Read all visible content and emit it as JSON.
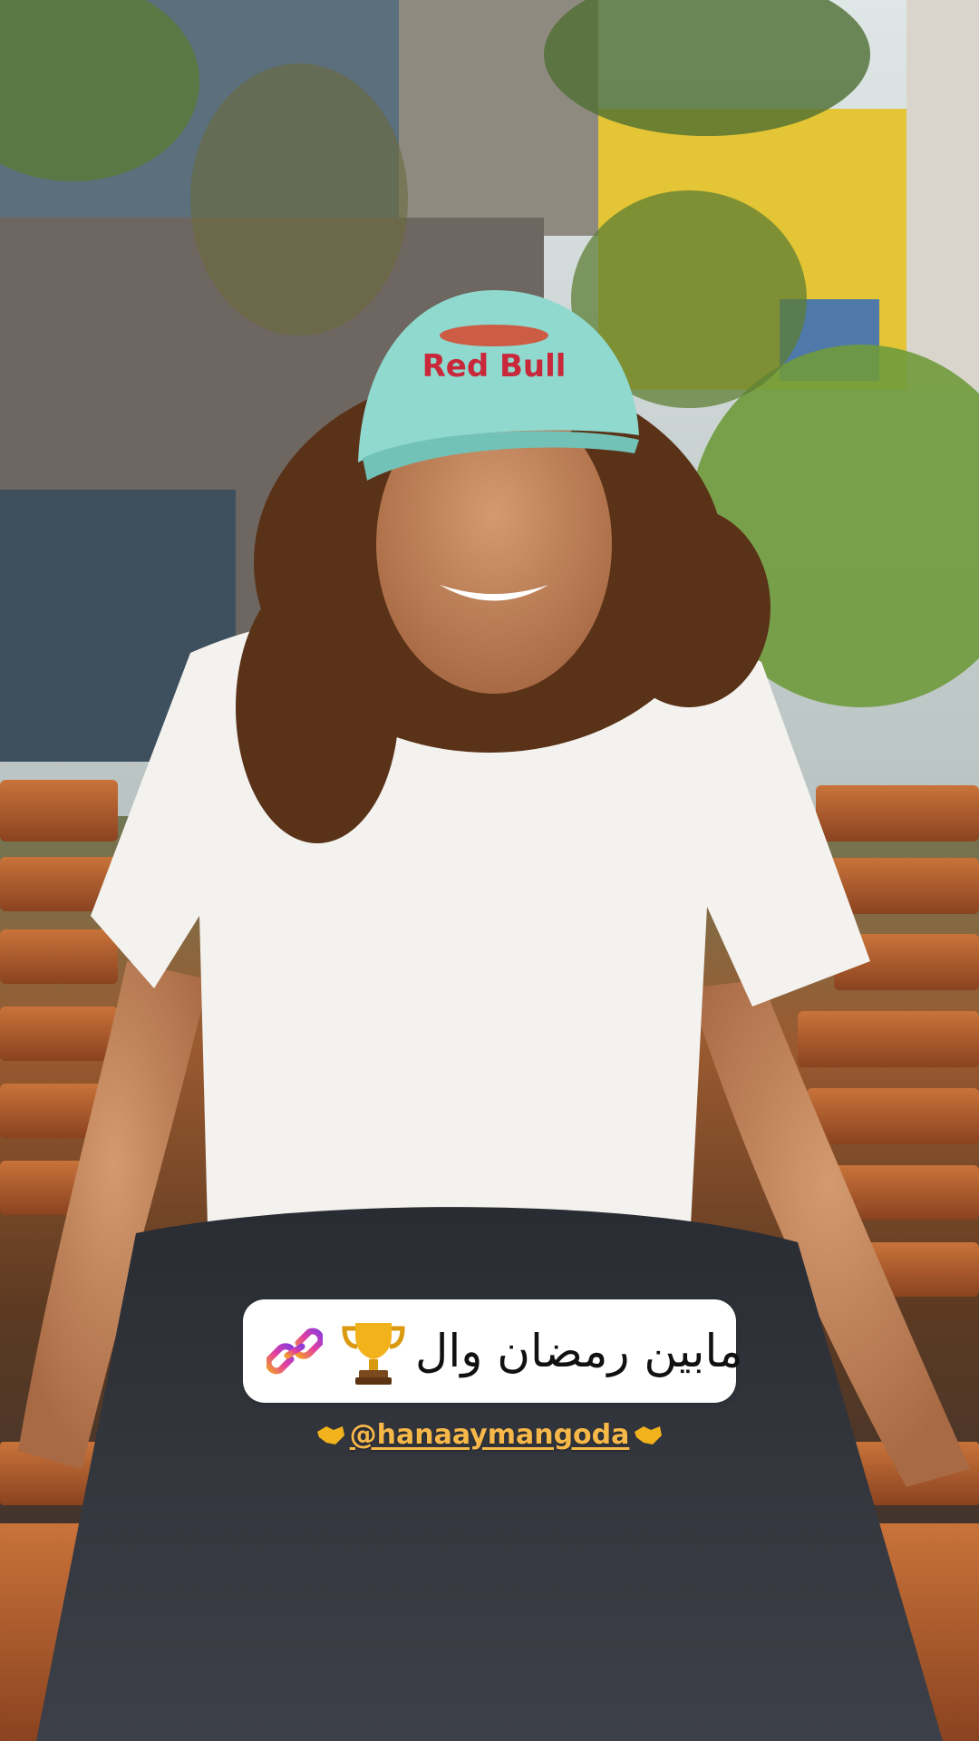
{
  "photo": {
    "subject": "Person seated on wooden bench wearing a mint Red Bull cap and white t-shirt",
    "cap_logo_text": "Red Bull"
  },
  "link_sticker": {
    "text": "مابين رمضان وال",
    "link_icon": "link-icon",
    "trophy_icon": "trophy-icon",
    "link_gradient": [
      "#f29a2e",
      "#e33ea0",
      "#8e3bd8"
    ]
  },
  "mention": {
    "handle": "@hanaaymangoda",
    "emoji_icon": "handshake-icon",
    "color": "#f7b84a"
  }
}
